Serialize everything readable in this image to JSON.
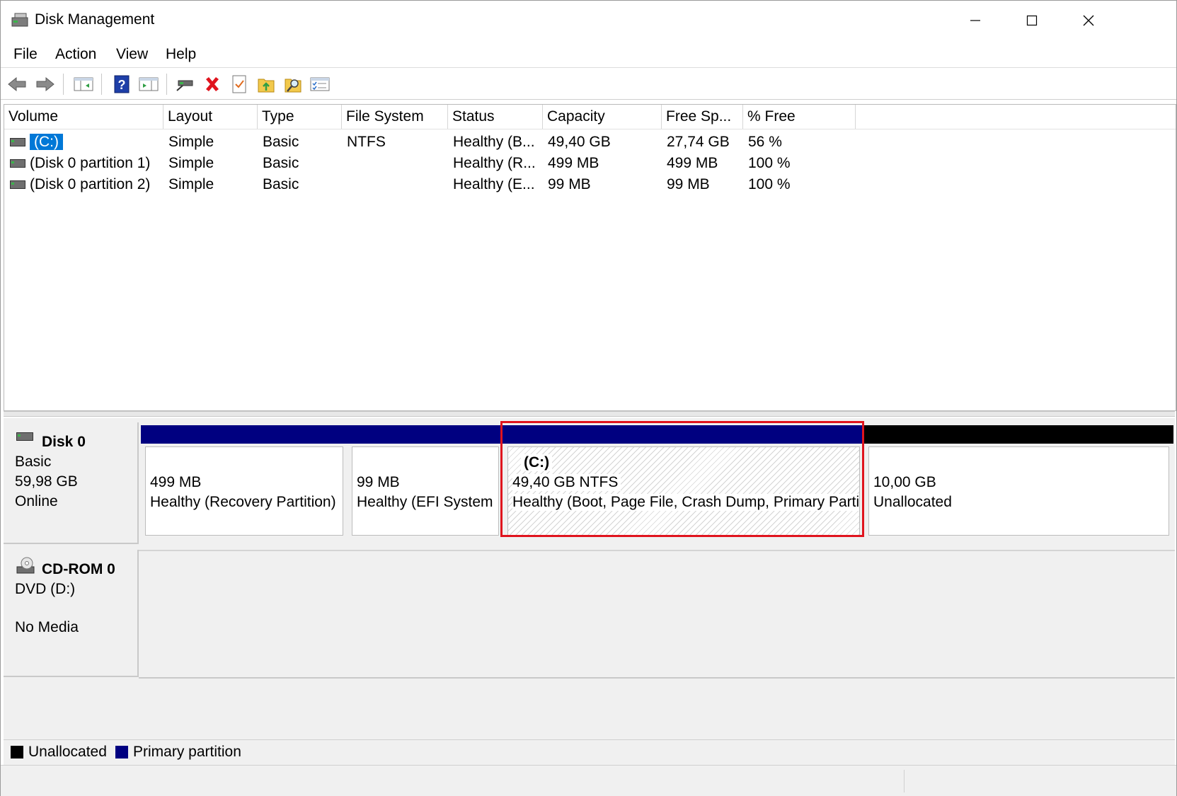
{
  "window": {
    "title": "Disk Management"
  },
  "menu": {
    "items": [
      "File",
      "Action",
      "View",
      "Help"
    ]
  },
  "toolbar": {
    "buttons": [
      "back-icon",
      "forward-icon",
      "show-hide-console-tree-icon",
      "help-icon",
      "properties-pane-icon",
      "connect-drive-icon",
      "delete-icon",
      "checkmark-doc-icon",
      "folder-up-icon",
      "search-folder-icon",
      "settings-list-icon"
    ]
  },
  "volume_list": {
    "columns": [
      "Volume",
      "Layout",
      "Type",
      "File System",
      "Status",
      "Capacity",
      "Free Sp...",
      "% Free"
    ],
    "rows": [
      {
        "volume": "(C:)",
        "layout": "Simple",
        "type": "Basic",
        "fs": "NTFS",
        "status": "Healthy (B...",
        "capacity": "49,40 GB",
        "free": "27,74 GB",
        "pct": "56 %"
      },
      {
        "volume": "(Disk 0 partition 1)",
        "layout": "Simple",
        "type": "Basic",
        "fs": "",
        "status": "Healthy (R...",
        "capacity": "499 MB",
        "free": "499 MB",
        "pct": "100 %"
      },
      {
        "volume": "(Disk 0 partition 2)",
        "layout": "Simple",
        "type": "Basic",
        "fs": "",
        "status": "Healthy (E...",
        "capacity": "99 MB",
        "free": "99 MB",
        "pct": "100 %"
      }
    ]
  },
  "disks": [
    {
      "name": "Disk 0",
      "type": "Basic",
      "size": "59,98 GB",
      "status": "Online",
      "partitions": [
        {
          "label": "",
          "line1": "499 MB",
          "line2": "Healthy (Recovery Partition)",
          "kind": "primary"
        },
        {
          "label": "",
          "line1": "99 MB",
          "line2": "Healthy (EFI System",
          "kind": "primary"
        },
        {
          "label": "(C:)",
          "line1": "49,40 GB NTFS",
          "line2": "Healthy (Boot, Page File, Crash Dump, Primary Partit",
          "kind": "primary",
          "selected": true
        },
        {
          "label": "",
          "line1": "10,00 GB",
          "line2": "Unallocated",
          "kind": "unallocated"
        }
      ]
    },
    {
      "name": "CD-ROM 0",
      "type": "DVD (D:)",
      "status": "No Media"
    }
  ],
  "legend": [
    {
      "label": "Unallocated",
      "color": "#000000"
    },
    {
      "label": "Primary partition",
      "color": "#000080"
    }
  ],
  "colors": {
    "primary": "#000080",
    "unallocated": "#000000",
    "selection": "#0078d7",
    "highlight": "#e0141e"
  }
}
